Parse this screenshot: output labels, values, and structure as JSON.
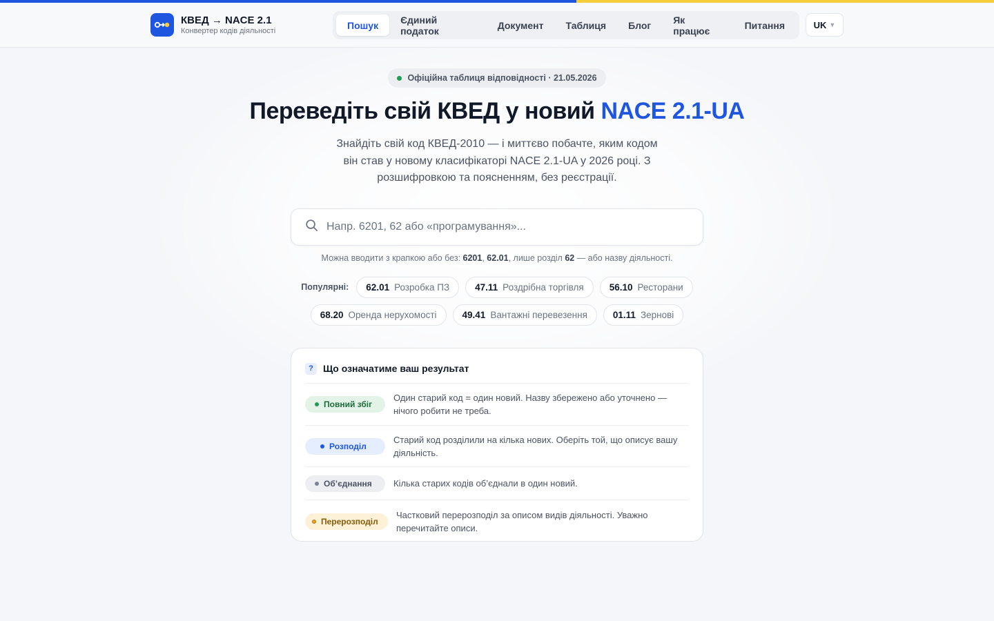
{
  "header": {
    "logo_title": "КВЕД → NACE 2.1",
    "logo_subtitle": "Конвертер кодів діяльності",
    "nav": [
      {
        "label": "Пошук",
        "active": true
      },
      {
        "label": "Єдиний податок",
        "active": false
      },
      {
        "label": "Документ",
        "active": false
      },
      {
        "label": "Таблиця",
        "active": false
      },
      {
        "label": "Блог",
        "active": false
      },
      {
        "label": "Як працює",
        "active": false
      },
      {
        "label": "Питання",
        "active": false
      }
    ],
    "language": "UK"
  },
  "hero": {
    "badge": "Офіційна таблиця відповідності · 21.05.2026",
    "title_main": "Переведіть свій КВЕД у новий ",
    "title_accent": "NACE 2.1-UA",
    "lead": "Знайдіть свій код КВЕД-2010 — і миттєво побачте, яким кодом він став у новому класифікаторі NACE 2.1-UA у 2026 році. З розшифровкою та поясненням, без реєстрації."
  },
  "search": {
    "placeholder": "Напр. 6201, 62 або «програмування»...",
    "value": "",
    "hint_prefix": "Можна вводити з крапкою або без: ",
    "hint_code1": "6201",
    "hint_sep": ", ",
    "hint_code2": "62.01",
    "hint_mid": ", лише розділ ",
    "hint_code3": "62",
    "hint_suffix": " — або назву діяльності."
  },
  "popular": {
    "label": "Популярні:",
    "items": [
      {
        "code": "62.01",
        "name": "Розробка ПЗ"
      },
      {
        "code": "47.11",
        "name": "Роздрібна торгівля"
      },
      {
        "code": "56.10",
        "name": "Ресторани"
      },
      {
        "code": "68.20",
        "name": "Оренда нерухомості"
      },
      {
        "code": "49.41",
        "name": "Вантажні перевезення"
      },
      {
        "code": "01.11",
        "name": "Зернові"
      }
    ]
  },
  "result_card": {
    "title": "Що означатиме ваш результат",
    "rows": [
      {
        "label": "Повний збіг",
        "text": "Один старий код = один новий. Назву збережено або уточнено — нічого робити не треба.",
        "color": "#1f9d55"
      },
      {
        "label": "Розподіл",
        "text": "Старий код розділили на кілька нових. Оберіть той, що описує вашу діяльність.",
        "color": "#1f56e0"
      },
      {
        "label": "Об’єднання",
        "text": "Кілька старих кодів об’єднали в один новий.",
        "color": "#7b8292"
      },
      {
        "label": "Перерозподіл",
        "text": "Частковий перерозподіл за описом видів діяльності. Уважно перечитайте описи.",
        "color": "#e8a21b"
      }
    ]
  },
  "colors": {
    "brand_blue": "#1f56e0",
    "brand_yellow": "#f7cd3c"
  }
}
